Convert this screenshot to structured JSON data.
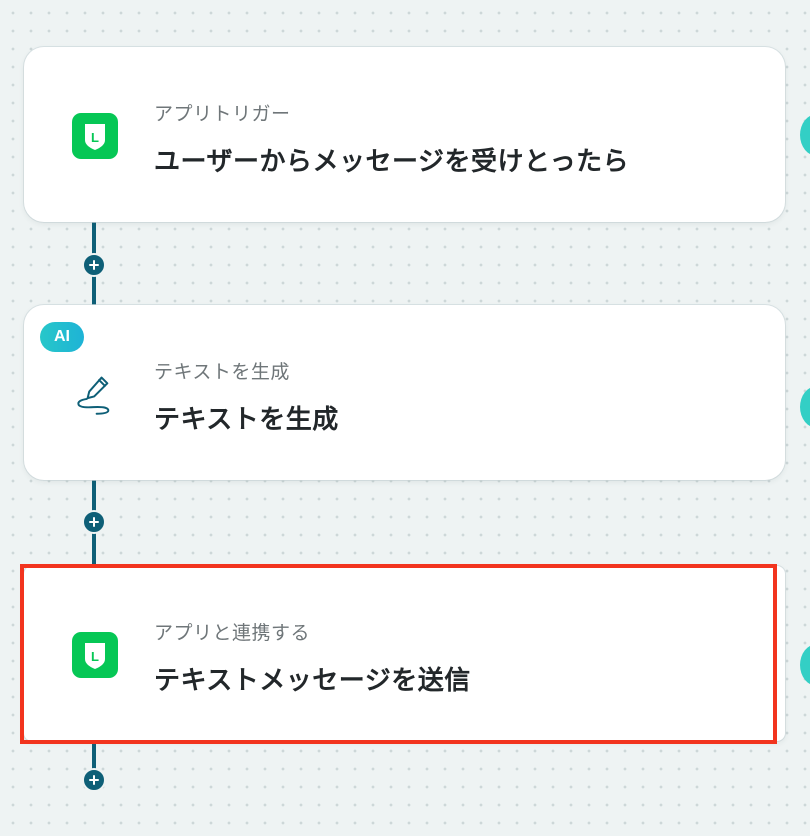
{
  "steps": [
    {
      "subtitle": "アプリトリガー",
      "title": "ユーザーからメッセージを受けとったら",
      "icon": "line-app-icon"
    },
    {
      "badge": "AI",
      "subtitle": "テキストを生成",
      "title": "テキストを生成",
      "icon": "pen-write-icon"
    },
    {
      "subtitle": "アプリと連携する",
      "title": "テキストメッセージを送信",
      "icon": "line-app-icon"
    }
  ],
  "colors": {
    "line_green": "#06c755",
    "connector": "#0e5f77",
    "highlight": "#f2341e",
    "ai_badge": "#27c7c9"
  },
  "icons": {
    "add_step": "plus-icon",
    "line_glyph": "L"
  }
}
